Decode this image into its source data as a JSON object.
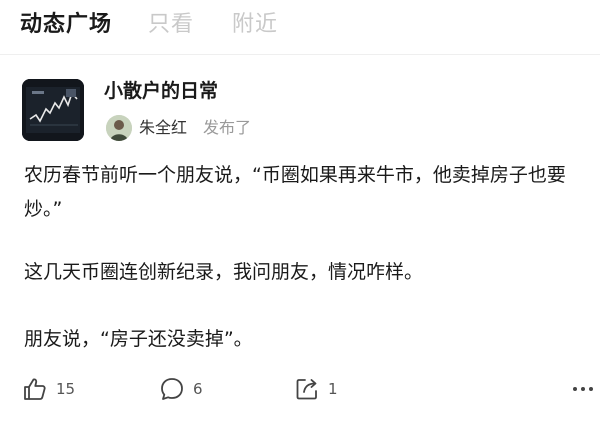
{
  "tabs": [
    {
      "label": "动态广场",
      "active": true
    },
    {
      "label": "只看",
      "active": false
    },
    {
      "label": "附近",
      "active": false
    }
  ],
  "post": {
    "group_name": "小散户的日常",
    "author": "朱全红",
    "action_text": "发布了",
    "paragraphs": [
      "农历春节前听一个朋友说，“币圈如果再来牛市，他卖掉房子也要炒。”",
      "这几天币圈连创新纪录，我问朋友，情况咋样。",
      "朋友说，“房子还没卖掉”。"
    ]
  },
  "actions": {
    "likes": "15",
    "comments": "6",
    "shares": "1"
  },
  "icons": {
    "like": "thumbs-up-icon",
    "comment": "comment-bubble-icon",
    "share": "share-icon",
    "more": "more-dots-icon"
  },
  "colors": {
    "text": "#1a1a1a",
    "inactive_tab": "#c9c9c9",
    "muted": "#9a9a9a",
    "icon": "#444444"
  }
}
